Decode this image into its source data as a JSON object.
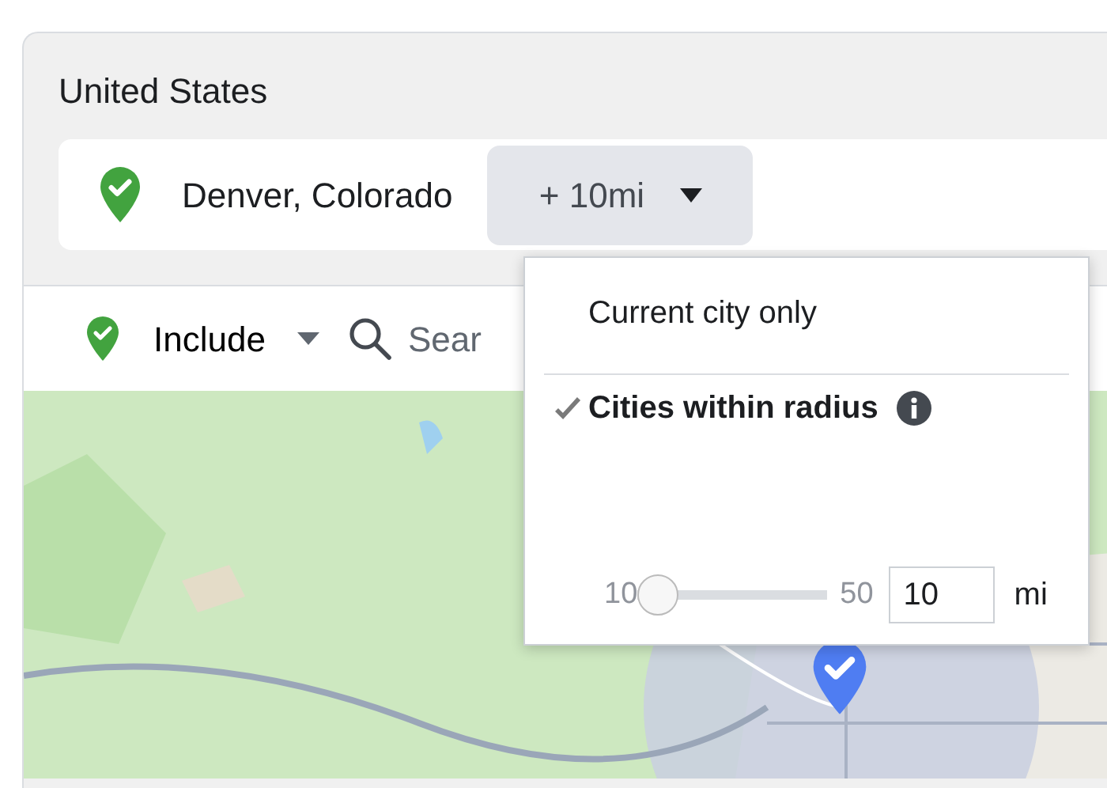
{
  "country": "United States",
  "location": {
    "name": "Denver, Colorado",
    "radius_button": "+ 10mi"
  },
  "filter": {
    "mode": "Include",
    "search_placeholder": "Sear"
  },
  "radius_menu": {
    "options": [
      {
        "label": "Current city only",
        "selected": false
      },
      {
        "label": "Cities within radius",
        "selected": true
      }
    ],
    "slider": {
      "min_label": "10",
      "max_label": "50",
      "level": 0,
      "value": "10",
      "unit": "mi"
    }
  }
}
